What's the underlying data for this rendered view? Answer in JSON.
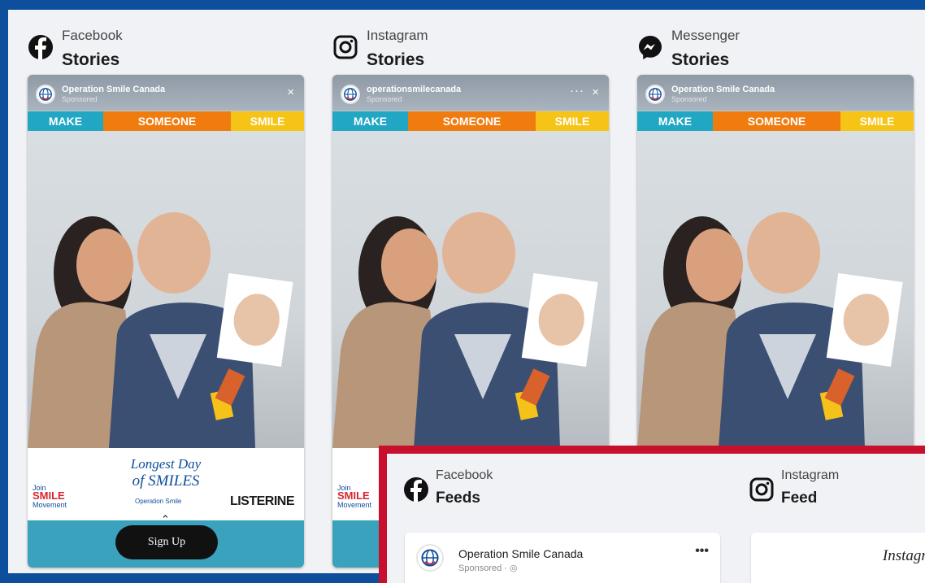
{
  "columns": [
    {
      "platform": "Facebook",
      "format": "Stories",
      "icon": "facebook-icon",
      "account": "Operation Smile Canada",
      "sponsored": "Sponsored",
      "close": "×"
    },
    {
      "platform": "Instagram",
      "format": "Stories",
      "icon": "instagram-icon",
      "account": "operationsmilecanada",
      "sponsored": "Sponsored",
      "close": "×",
      "more": "···"
    },
    {
      "platform": "Messenger",
      "format": "Stories",
      "icon": "messenger-icon",
      "account": "Operation Smile Canada",
      "sponsored": "Sponsored",
      "close": ""
    }
  ],
  "banner": {
    "w1": "MAKE",
    "w2": "SOMEONE",
    "w3": "SMILE"
  },
  "footer": {
    "lds_line1": "Longest Day",
    "lds_line2": "of SMILES",
    "join_line1": "Join",
    "join_line2": "SMILE",
    "join_line3": "Movement",
    "operation_smile": "Operation Smile",
    "listerine": "LISTERINE",
    "signup": "Sign Up"
  },
  "feeds": [
    {
      "platform": "Facebook",
      "format": "Feeds",
      "icon": "facebook-icon",
      "account": "Operation Smile Canada",
      "sponsored": "Sponsored · ",
      "more": "•••"
    },
    {
      "platform": "Instagram",
      "format": "Feed",
      "icon": "instagram-icon",
      "wordmark": "Instagram"
    }
  ],
  "colors": {
    "frame_blue": "#0d4f9c",
    "frame_red": "#c8102e",
    "make_teal": "#21a7c4",
    "someone_orange": "#f07c10",
    "smile_yellow": "#f6c416"
  }
}
